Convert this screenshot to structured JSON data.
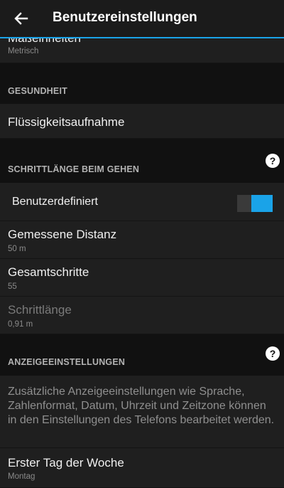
{
  "appbar": {
    "title": "Benutzereinstellungen",
    "back_icon": "arrow-left-icon"
  },
  "units": {
    "title": "Maßeinheiten",
    "value": "Metrisch"
  },
  "sections": {
    "health": "GESUNDHEIT",
    "stride": "SCHRITTLÄNGE BEIM GEHEN",
    "display": "ANZEIGEEINSTELLUNGEN"
  },
  "health": {
    "fluid": "Flüssigkeitsaufnahme"
  },
  "stride": {
    "custom_label": "Benutzerdefiniert",
    "custom_enabled": true,
    "distance_title": "Gemessene Distanz",
    "distance_value": "50 m",
    "steps_title": "Gesamtschritte",
    "steps_value": "55",
    "length_title": "Schrittlänge",
    "length_value": "0,91 m"
  },
  "display": {
    "info": "Zusätzliche Anzeigeeinstellungen wie Sprache, Zahlenformat, Datum, Uhrzeit und Zeitzone können in den Einstellungen des Telefons bearbeitet werden.",
    "first_day_title": "Erster Tag der Woche",
    "first_day_value": "Montag"
  },
  "help_glyph": "?",
  "colors": {
    "accent": "#1aa3e8",
    "background": "#111111",
    "row": "#1f1f1f"
  }
}
